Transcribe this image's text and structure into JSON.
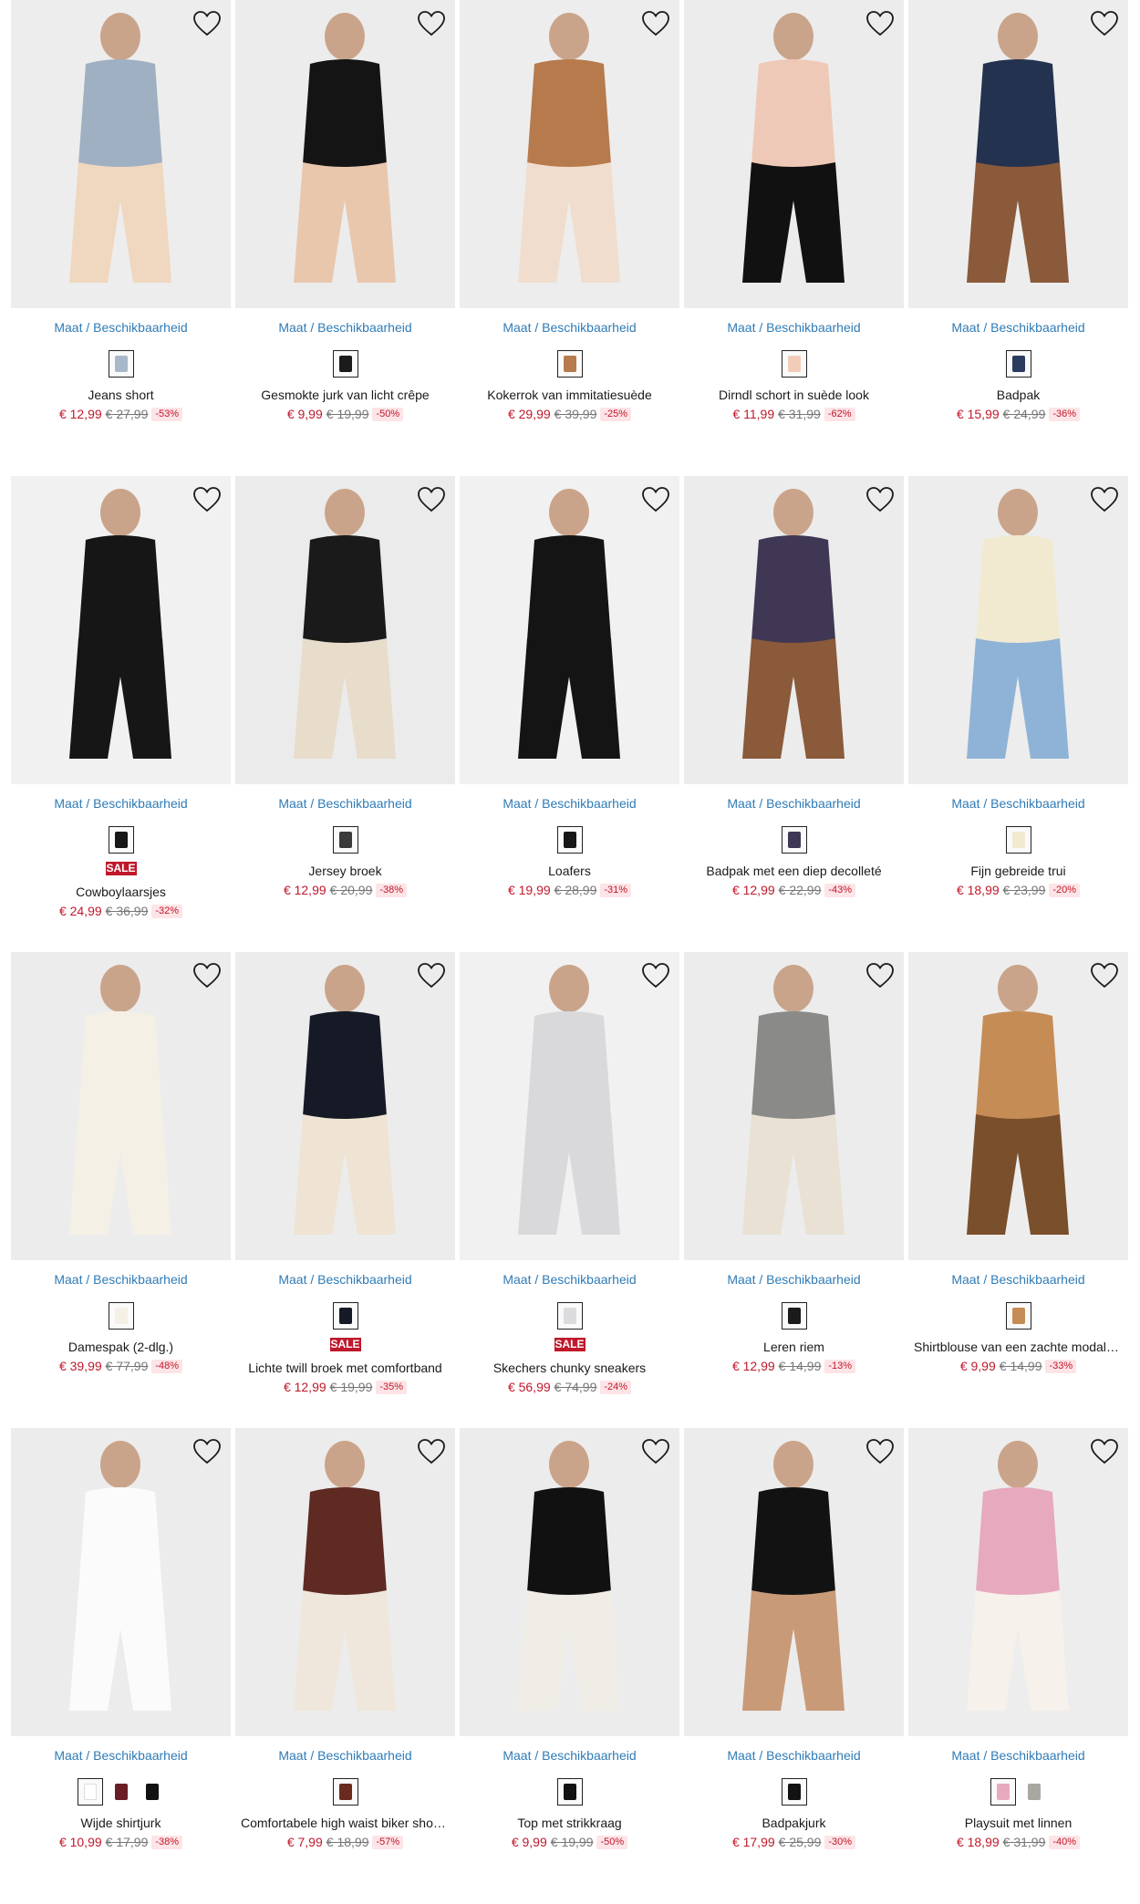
{
  "size_label": "Maat / Beschikbaarheid",
  "sale_badge": "SALE",
  "products": [
    {
      "title": "Jeans short",
      "price": "€ 12,99",
      "old": "€ 27,99",
      "disc": "-53%",
      "sale": false,
      "bg": "#ededed",
      "colors": [
        "#9fb0c2",
        "#f0d7bf"
      ],
      "swatches": [
        "#a9b8c9"
      ]
    },
    {
      "title": "Gesmokte jurk van licht crêpe",
      "price": "€ 9,99",
      "old": "€ 19,99",
      "disc": "-50%",
      "sale": false,
      "bg": "#ececec",
      "colors": [
        "#141414",
        "#e9c7ad"
      ],
      "swatches": [
        "#1b1b1b"
      ]
    },
    {
      "title": "Kokerrok van immitatiesuède",
      "price": "€ 29,99",
      "old": "€ 39,99",
      "disc": "-25%",
      "sale": false,
      "bg": "#ededed",
      "colors": [
        "#b77a4c",
        "#f0ddcd"
      ],
      "swatches": [
        "#b77a4c"
      ]
    },
    {
      "title": "Dirndl schort in suède look",
      "price": "€ 11,99",
      "old": "€ 31,99",
      "disc": "-62%",
      "sale": false,
      "bg": "#ececec",
      "colors": [
        "#efc9b7",
        "#111111"
      ],
      "swatches": [
        "#f1cdb9"
      ]
    },
    {
      "title": "Badpak",
      "price": "€ 15,99",
      "old": "€ 24,99",
      "disc": "-36%",
      "sale": false,
      "bg": "#ededed",
      "colors": [
        "#23324f",
        "#8a5a3a"
      ],
      "swatches": [
        "#2a3b5e"
      ]
    },
    {
      "title": "Cowboylaarsjes",
      "price": "€ 24,99",
      "old": "€ 36,99",
      "disc": "-32%",
      "sale": true,
      "bg": "#f1f1f1",
      "colors": [
        "#161616",
        "#161616"
      ],
      "swatches": [
        "#161616"
      ]
    },
    {
      "title": "Jersey broek",
      "price": "€ 12,99",
      "old": "€ 20,99",
      "disc": "-38%",
      "sale": false,
      "bg": "#ebebeb",
      "colors": [
        "#1a1a1a",
        "#e8dccb"
      ],
      "swatches": [
        "#3a3a3a"
      ]
    },
    {
      "title": "Loafers",
      "price": "€ 19,99",
      "old": "€ 28,99",
      "disc": "-31%",
      "sale": false,
      "bg": "#f1f1f1",
      "colors": [
        "#141414",
        "#141414"
      ],
      "swatches": [
        "#161616"
      ]
    },
    {
      "title": "Badpak met een diep decolleté",
      "price": "€ 12,99",
      "old": "€ 22,99",
      "disc": "-43%",
      "sale": false,
      "bg": "#ececec",
      "colors": [
        "#3f3754",
        "#8a5a3a"
      ],
      "swatches": [
        "#3f3754"
      ]
    },
    {
      "title": "Fijn gebreide trui",
      "price": "€ 18,99",
      "old": "€ 23,99",
      "disc": "-20%",
      "sale": false,
      "bg": "#ededed",
      "colors": [
        "#f1ead1",
        "#8fb3d6"
      ],
      "swatches": [
        "#f1ead1"
      ]
    },
    {
      "title": "Damespak (2-dlg.)",
      "price": "€ 39,99",
      "old": "€ 77,99",
      "disc": "-48%",
      "sale": false,
      "bg": "#ececec",
      "colors": [
        "#f4f0e6",
        "#f4f0e6"
      ],
      "swatches": [
        "#f4f0e6"
      ]
    },
    {
      "title": "Lichte twill broek met comfortband",
      "price": "€ 12,99",
      "old": "€ 19,99",
      "disc": "-35%",
      "sale": true,
      "bg": "#ececec",
      "colors": [
        "#151a26",
        "#efe4d3"
      ],
      "swatches": [
        "#151a26"
      ]
    },
    {
      "title": "Skechers chunky sneakers",
      "price": "€ 56,99",
      "old": "€ 74,99",
      "disc": "-24%",
      "sale": true,
      "bg": "#f1f1f1",
      "colors": [
        "#d9d9dc",
        "#d9d9dc"
      ],
      "swatches": [
        "#dcdcdf"
      ]
    },
    {
      "title": "Leren riem",
      "price": "€ 12,99",
      "old": "€ 14,99",
      "disc": "-13%",
      "sale": false,
      "bg": "#ececec",
      "colors": [
        "#8a8a88",
        "#e8e1d4"
      ],
      "swatches": [
        "#1b1b1b"
      ]
    },
    {
      "title": "Shirtblouse van een zachte modalmix",
      "price": "€ 9,99",
      "old": "€ 14,99",
      "disc": "-33%",
      "sale": false,
      "bg": "#ededed",
      "colors": [
        "#c68c56",
        "#7a4f2b"
      ],
      "swatches": [
        "#c68c56"
      ]
    },
    {
      "title": "Wijde shirtjurk",
      "price": "€ 10,99",
      "old": "€ 17,99",
      "disc": "-38%",
      "sale": false,
      "bg": "#ececec",
      "colors": [
        "#fbfbfb",
        "#fbfbfb"
      ],
      "swatches": [
        "#ffffff",
        "#6b1d25",
        "#111111"
      ]
    },
    {
      "title": "Comfortabele high waist biker shor…",
      "price": "€ 7,99",
      "old": "€ 18,99",
      "disc": "-57%",
      "sale": false,
      "bg": "#ececec",
      "colors": [
        "#5e2a22",
        "#efe7dc"
      ],
      "swatches": [
        "#6b2a20"
      ]
    },
    {
      "title": "Top met strikkraag",
      "price": "€ 9,99",
      "old": "€ 19,99",
      "disc": "-50%",
      "sale": false,
      "bg": "#ececec",
      "colors": [
        "#111111",
        "#f0ece6"
      ],
      "swatches": [
        "#111111"
      ]
    },
    {
      "title": "Badpakjurk",
      "price": "€ 17,99",
      "old": "€ 25,99",
      "disc": "-30%",
      "sale": false,
      "bg": "#ececec",
      "colors": [
        "#121212",
        "#c89a78"
      ],
      "swatches": [
        "#121212"
      ]
    },
    {
      "title": "Playsuit met linnen",
      "price": "€ 18,99",
      "old": "€ 31,99",
      "disc": "-40%",
      "sale": false,
      "bg": "#ededed",
      "colors": [
        "#e7a9bd",
        "#f6f1ea"
      ],
      "swatches": [
        "#e7a9bd",
        "#a8a8a0"
      ]
    }
  ]
}
